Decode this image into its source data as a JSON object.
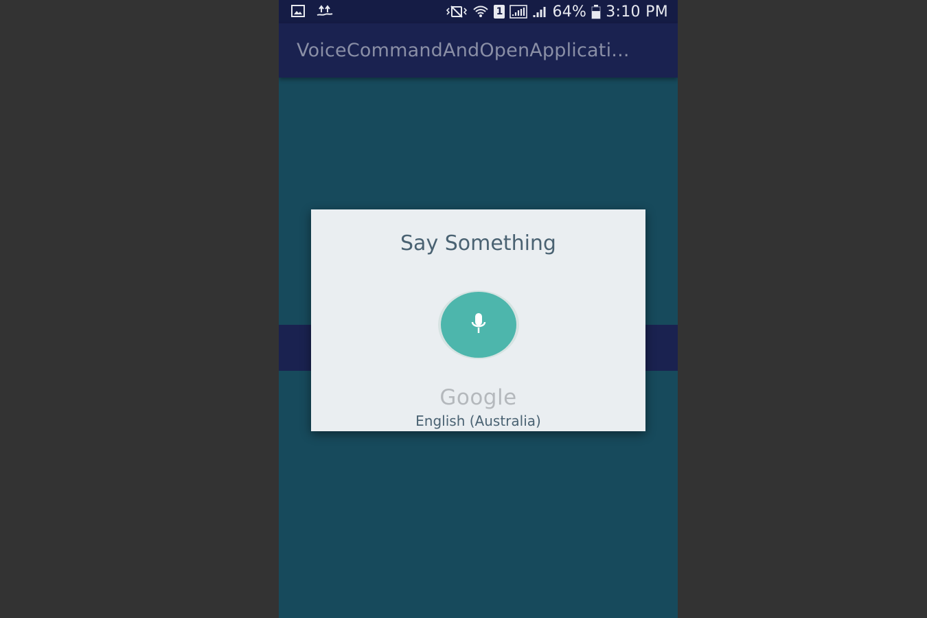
{
  "status_bar": {
    "left_icons": [
      "gallery-icon",
      "usb-upload-icon"
    ],
    "right_icons": [
      "vibrate-icon",
      "wifi-icon",
      "sim-icon",
      "signal-icon",
      "signal-icon",
      "battery-icon"
    ],
    "sim_number": "1",
    "battery_percent": "64%",
    "battery_level": 0.64,
    "time": "3:10 PM"
  },
  "app_bar": {
    "title": "VoiceCommandAndOpenApplicati..."
  },
  "dialog": {
    "title": "Say Something",
    "mic_icon": "microphone-icon",
    "brand": "Google",
    "language": "English (Australia)"
  },
  "colors": {
    "status_bar": "#151c45",
    "app_bar": "#1a2250",
    "content_bg": "#174a5c",
    "outer_bg": "#333333",
    "dialog_bg": "#eaeef1",
    "mic_button": "#4db6ac",
    "text_primary": "#4a6272"
  }
}
